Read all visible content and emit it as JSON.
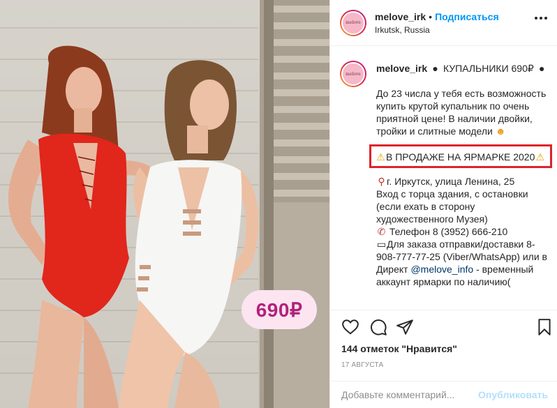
{
  "post": {
    "price_badge": "690₽"
  },
  "header": {
    "username": "melove_irk",
    "separator": "•",
    "follow_label": "Подписаться",
    "location": "Irkutsk, Russia",
    "avatar_text": "melove"
  },
  "caption": {
    "username": "melove_irk",
    "title": "КУПАЛЬНИКИ 690₽",
    "paragraph1": "До 23 числа у тебя есть возможность купить крутой купальник по очень приятной цене! В наличии двойки, тройки и слитные модели",
    "highlight": "В ПРОДАЖЕ НА ЯРМАРКЕ 2020",
    "address": "г. Иркутск, улица Ленина, 25",
    "entrance": "Вход с торца здания, с остановки (если ехать в сторону художественного Музея)",
    "phone": "Телефон 8 (3952) 666-210",
    "order_prefix": "Для заказа отправки/доставки 8-908-777-77-25 (Viber/WhatsApp) или в Директ",
    "mention": "@melove_info",
    "order_suffix": "- временный аккаунт ярмарки по наличию(",
    "icons": {
      "bomb": "bomb-emoji",
      "heart_eyes": "heart-eyes-emoji",
      "warning": "warning-emoji",
      "pin": "pin-emoji",
      "phone": "phone-emoji",
      "laptop": "laptop-emoji"
    }
  },
  "actions": {
    "likes": "144 отметок \"Нравится\"",
    "date": "17 АВГУСТА"
  },
  "comment": {
    "placeholder": "Добавьте комментарий...",
    "publish_label": "Опубликовать"
  },
  "colors": {
    "follow": "#0095f6",
    "highlight_border": "#e0232a",
    "price_badge_bg": "#fde4f1",
    "price_badge_text": "#b0237a"
  }
}
